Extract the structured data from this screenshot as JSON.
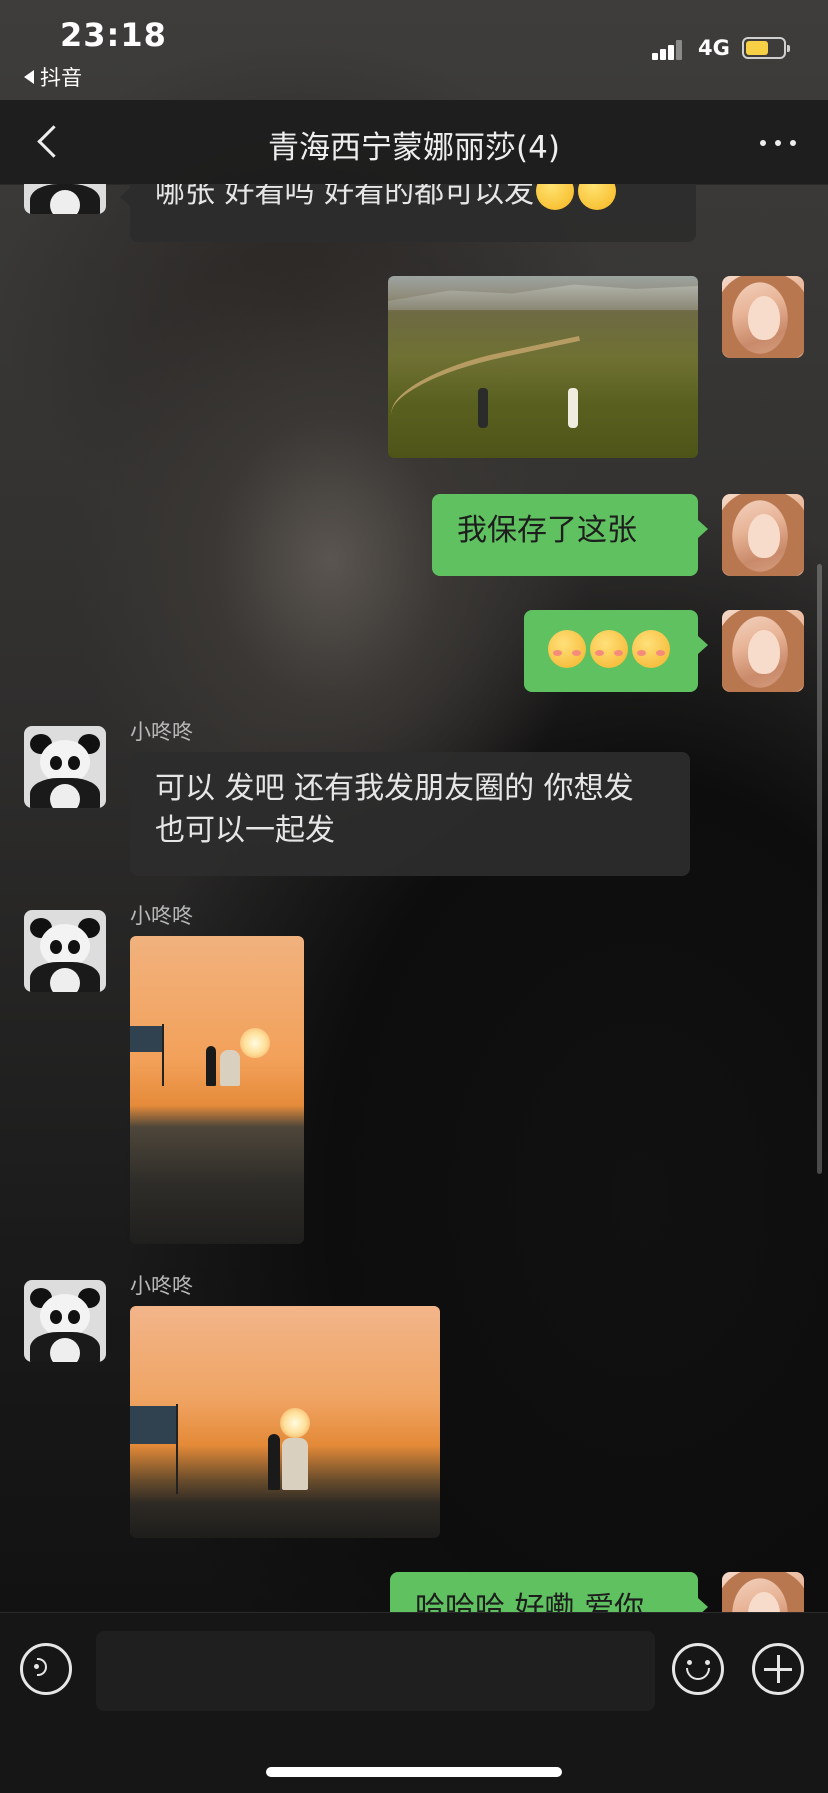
{
  "status_bar": {
    "time": "23:18",
    "back_app": "抖音",
    "network": "4G",
    "battery_level": 0.6
  },
  "nav": {
    "title": "青海西宁蒙娜丽莎(4)"
  },
  "messages": [
    {
      "side": "left",
      "type": "text",
      "text": "哪张 好看吗 好看的都可以发",
      "emoji": [
        "wink",
        "wink"
      ]
    },
    {
      "side": "right",
      "type": "image",
      "image": "grassland-couple-photo"
    },
    {
      "side": "right",
      "type": "text",
      "text": "我保存了这张"
    },
    {
      "side": "right",
      "type": "emoji",
      "emoji": [
        "blush",
        "blush",
        "blush"
      ]
    },
    {
      "side": "left",
      "sender": "小咚咚",
      "type": "text",
      "text": "可以 发吧 还有我发朋友圈的 你想发 也可以一起发"
    },
    {
      "side": "left",
      "sender": "小咚咚",
      "type": "image",
      "image": "sunset-couple-photo-portrait"
    },
    {
      "side": "left",
      "sender": "小咚咚",
      "type": "image",
      "image": "sunset-couple-photo-landscape"
    },
    {
      "side": "right",
      "type": "text",
      "text": "哈哈哈 好嘞 爱你"
    }
  ],
  "input_bar": {
    "voice_icon": "voice-icon",
    "emoji_icon": "emoji-icon",
    "plus_icon": "plus-icon"
  },
  "colors": {
    "right_bubble": "#5fc160",
    "left_bubble": "#2c2c2c",
    "battery": "#f7d046"
  }
}
